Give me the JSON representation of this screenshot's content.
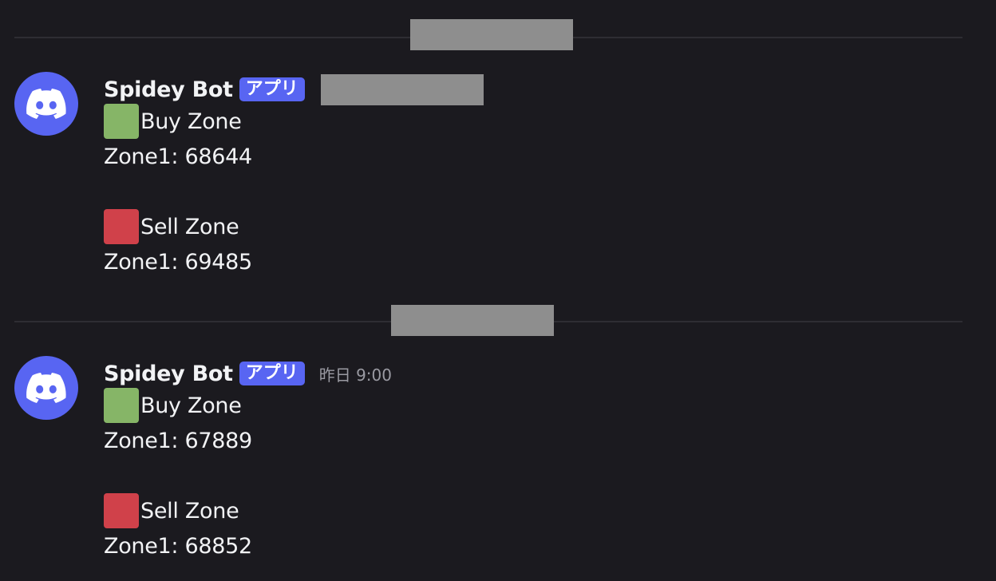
{
  "colors": {
    "background": "#1b1a1f",
    "avatar": "#5865f2",
    "badge": "#5865f2",
    "buy_square": "#86b567",
    "sell_square": "#d0414a",
    "redaction": "#8e8e8e"
  },
  "icons": {
    "avatar": "discord-logo-icon",
    "buy": "green-square-emoji",
    "sell": "red-square-emoji"
  },
  "messages": [
    {
      "username": "Spidey Bot",
      "badge": "アプリ",
      "timestamp": "",
      "buy_label": "Buy Zone",
      "buy_zone": "Zone1: 68644",
      "sell_label": "Sell Zone",
      "sell_zone": "Zone1: 69485"
    },
    {
      "username": "Spidey Bot",
      "badge": "アプリ",
      "timestamp": "昨日 9:00",
      "buy_label": "Buy Zone",
      "buy_zone": "Zone1: 67889",
      "sell_label": "Sell Zone",
      "sell_zone": "Zone1: 68852"
    }
  ]
}
